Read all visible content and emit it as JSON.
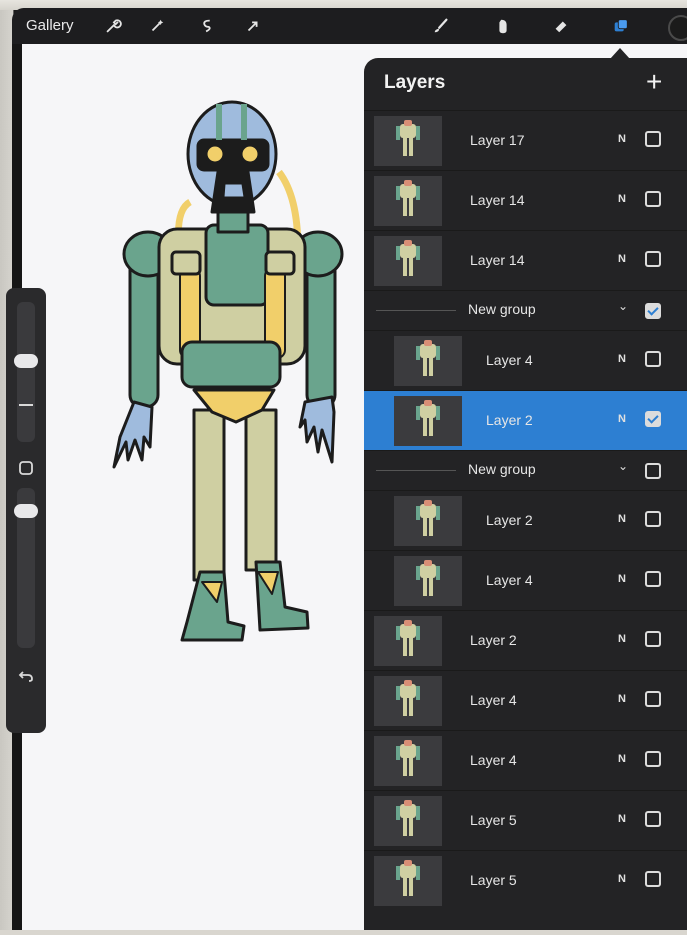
{
  "toolbar": {
    "gallery_label": "Gallery",
    "left_tools": [
      "wrench-icon",
      "magic-wand-icon",
      "selection-icon",
      "transform-arrow-icon"
    ],
    "right_tools": [
      "brush-icon",
      "smudge-icon",
      "eraser-icon",
      "layers-icon"
    ],
    "active_tool": "layers-icon",
    "accent": "#2d7fd2"
  },
  "sidebar": {
    "controls": [
      "brush-size-slider",
      "modify-button",
      "brush-opacity-slider",
      "undo-icon"
    ]
  },
  "layers_panel": {
    "title": "Layers",
    "add_label": "+",
    "rows": [
      {
        "type": "layer",
        "name": "Layer 17",
        "blend": "N",
        "visible": false,
        "selected": false,
        "indented": false
      },
      {
        "type": "layer",
        "name": "Layer 14",
        "blend": "N",
        "visible": false,
        "selected": false,
        "indented": false
      },
      {
        "type": "layer",
        "name": "Layer 14",
        "blend": "N",
        "visible": false,
        "selected": false,
        "indented": false
      },
      {
        "type": "group",
        "name": "New group",
        "chevron": "⌄",
        "visible": true
      },
      {
        "type": "layer",
        "name": "Layer 4",
        "blend": "N",
        "visible": false,
        "selected": false,
        "indented": true
      },
      {
        "type": "layer",
        "name": "Layer 2",
        "blend": "N",
        "visible": true,
        "selected": true,
        "indented": true
      },
      {
        "type": "group",
        "name": "New group",
        "chevron": "⌄",
        "visible": false
      },
      {
        "type": "layer",
        "name": "Layer 2",
        "blend": "N",
        "visible": false,
        "selected": false,
        "indented": true
      },
      {
        "type": "layer",
        "name": "Layer 4",
        "blend": "N",
        "visible": false,
        "selected": false,
        "indented": true
      },
      {
        "type": "layer",
        "name": "Layer 2",
        "blend": "N",
        "visible": false,
        "selected": false,
        "indented": false
      },
      {
        "type": "layer",
        "name": "Layer 4",
        "blend": "N",
        "visible": false,
        "selected": false,
        "indented": false
      },
      {
        "type": "layer",
        "name": "Layer 4",
        "blend": "N",
        "visible": false,
        "selected": false,
        "indented": false
      },
      {
        "type": "layer",
        "name": "Layer 5",
        "blend": "N",
        "visible": false,
        "selected": false,
        "indented": false
      },
      {
        "type": "layer",
        "name": "Layer 5",
        "blend": "N",
        "visible": false,
        "selected": false,
        "indented": false
      }
    ]
  },
  "artwork": {
    "colors": {
      "sage": "#6aa48d",
      "khaki": "#cfcfa2",
      "yellow": "#f1cf6a",
      "blue": "#9fbbdd",
      "dark": "#1c1c1c"
    }
  }
}
